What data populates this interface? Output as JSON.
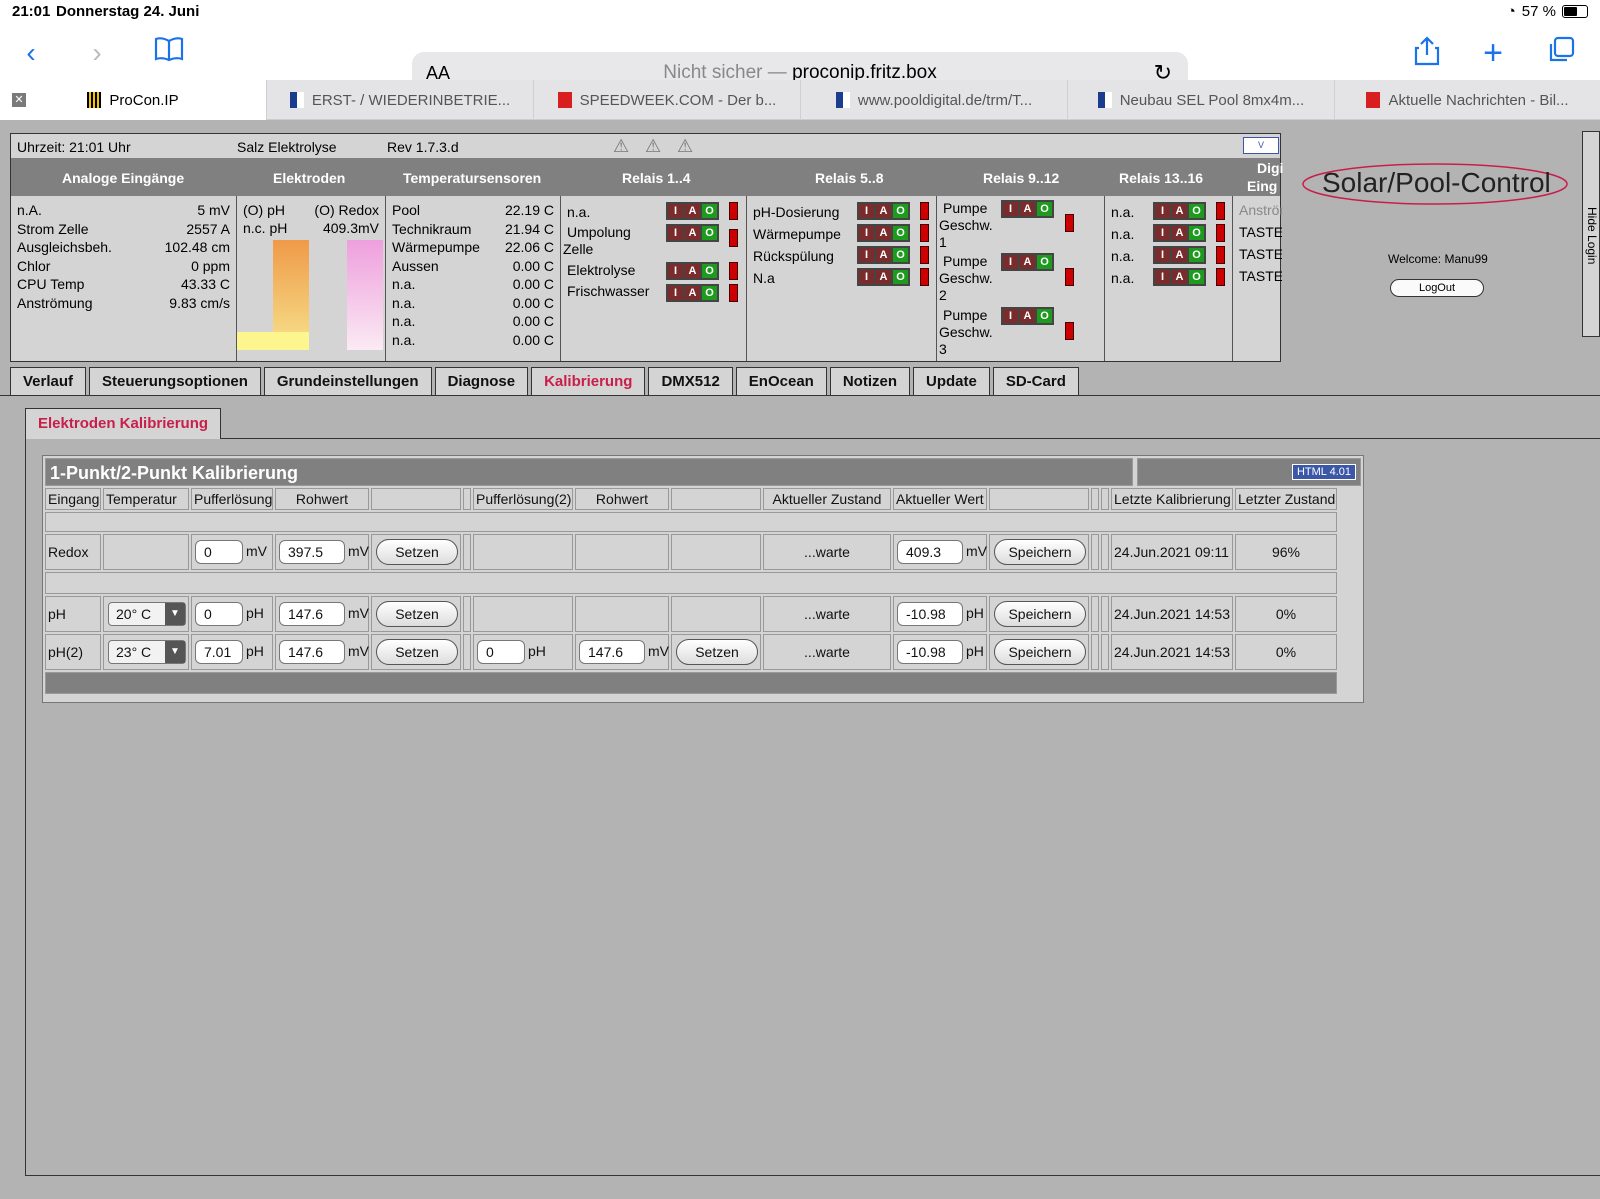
{
  "status": {
    "time": "21:01",
    "date": "Donnerstag 24. Juni",
    "battery": "57 %"
  },
  "browser": {
    "address_prefix": "Nicht sicher —",
    "address_host": "proconip.fritz.box",
    "aa": "AA",
    "tabs": [
      {
        "label": "ProCon.IP",
        "active": true
      },
      {
        "label": "ERST- / WIEDERINBETRIE..."
      },
      {
        "label": "SPEEDWEEK.COM - Der b..."
      },
      {
        "label": "www.pooldigital.de/trm/T..."
      },
      {
        "label": "Neubau SEL Pool 8mx4m..."
      },
      {
        "label": "Aktuelle Nachrichten - Bil..."
      }
    ]
  },
  "topline": {
    "clock": "Uhrzeit: 21:01 Uhr",
    "mode": "Salz Elektrolyse",
    "rev": "Rev 1.7.3.d"
  },
  "headers": {
    "analog": "Analoge Eingänge",
    "elektroden": "Elektroden",
    "temp": "Temperatursensoren",
    "relais1": "Relais 1..4",
    "relais5": "Relais 5..8",
    "relais9": "Relais 9..12",
    "relais13": "Relais 13..16",
    "digi": "Digi",
    "eing": "Eing"
  },
  "analog": [
    {
      "name": "n.A.",
      "value": "5 mV"
    },
    {
      "name": "Strom Zelle",
      "value": "2557 A"
    },
    {
      "name": "Ausgleichsbeh.",
      "value": "102.48 cm"
    },
    {
      "name": "Chlor",
      "value": "0 ppm"
    },
    {
      "name": "CPU Temp",
      "value": "43.33 C"
    },
    {
      "name": "Anströmung",
      "value": "9.83 cm/s"
    }
  ],
  "elektroden": {
    "ph_label": "(O) pH",
    "redox_label": "(O) Redox",
    "ph_value": "n.c. pH",
    "redox_value": "409.3mV"
  },
  "temps": [
    {
      "name": "Pool",
      "value": "22.19 C"
    },
    {
      "name": "Technikraum",
      "value": "21.94 C"
    },
    {
      "name": "Wärmepumpe",
      "value": "22.06 C"
    },
    {
      "name": "Aussen",
      "value": "0.00 C"
    },
    {
      "name": "n.a.",
      "value": "0.00 C"
    },
    {
      "name": "n.a.",
      "value": "0.00 C"
    },
    {
      "name": "n.a.",
      "value": "0.00 C"
    },
    {
      "name": "n.a.",
      "value": "0.00 C"
    }
  ],
  "relais1": [
    "n.a.",
    "Umpolung",
    "Zelle",
    "Elektrolyse",
    "Frischwasser"
  ],
  "relais5": [
    "pH-Dosierung",
    "Wärmepumpe",
    "Rückspülung",
    "N.a"
  ],
  "relais9": [
    "Pumpe",
    "Geschw.",
    "1",
    "Pumpe",
    "Geschw.",
    "2",
    "Pumpe",
    "Geschw.",
    "3"
  ],
  "relais13": [
    "n.a.",
    "n.a.",
    "n.a.",
    "n.a."
  ],
  "digital": [
    "Anström",
    "TASTEF",
    "TASTEF",
    "TASTEF"
  ],
  "iao": {
    "i": "I",
    "a": "A",
    "o": "O"
  },
  "login": {
    "logo": "Solar/Pool-Control",
    "welcome": "Welcome:  Manu99",
    "logout": "LogOut",
    "hide": "Hide Login"
  },
  "main_tabs": [
    "Verlauf",
    "Steuerungsoptionen",
    "Grundeinstellungen",
    "Diagnose",
    "Kalibrierung",
    "DMX512",
    "EnOcean",
    "Notizen",
    "Update",
    "SD-Card"
  ],
  "active_tab": "Kalibrierung",
  "subtab": "Elektroden Kalibrierung",
  "calib": {
    "title": "1-Punkt/2-Punkt Kalibrierung",
    "badge": "HTML 4.01",
    "columns": [
      "Eingang",
      "Temperatur",
      "Pufferlösung",
      "Rohwert",
      "Pufferlösung(2)",
      "Rohwert",
      "Aktueller Zustand",
      "Aktueller Wert",
      "Letzte Kalibrierung",
      "Letzter Zustand"
    ],
    "rows": [
      {
        "name": "Redox",
        "temp": "",
        "buffer": "0",
        "buffer_unit": "mV",
        "raw": "397.5",
        "raw_unit": "mV",
        "set": "Setzen",
        "state": "...warte",
        "value": "409.3",
        "value_unit": "mV",
        "save": "Speichern",
        "last": "24.Jun.2021 09:11",
        "last_state": "96%"
      },
      {
        "name": "pH",
        "temp": "20° C",
        "buffer": "0",
        "buffer_unit": "pH",
        "raw": "147.6",
        "raw_unit": "mV",
        "set": "Setzen",
        "state": "...warte",
        "value": "-10.98",
        "value_unit": "pH",
        "save": "Speichern",
        "last": "24.Jun.2021 14:53",
        "last_state": "0%"
      },
      {
        "name": "pH(2)",
        "temp": "23° C",
        "buffer": "7.01",
        "buffer_unit": "pH",
        "raw": "147.6",
        "raw_unit": "mV",
        "set": "Setzen",
        "buffer2": "0",
        "buffer2_unit": "pH",
        "raw2": "147.6",
        "raw2_unit": "mV",
        "set2": "Setzen",
        "state": "...warte",
        "value": "-10.98",
        "value_unit": "pH",
        "save": "Speichern",
        "last": "24.Jun.2021 14:53",
        "last_state": "0%"
      }
    ]
  }
}
